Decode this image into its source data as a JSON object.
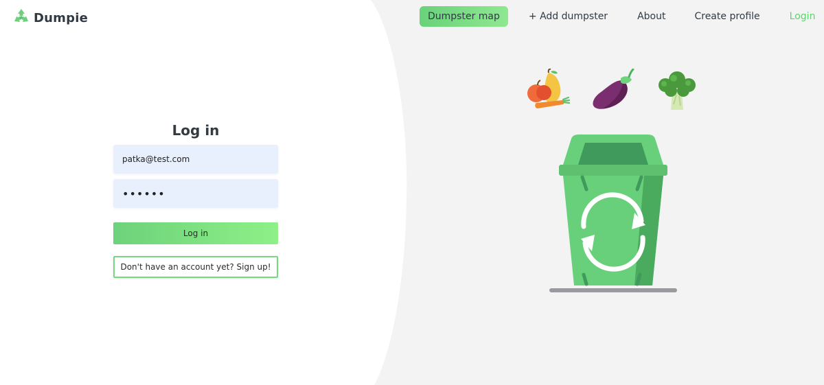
{
  "brand": {
    "name": "Dumpie",
    "logo_icon": "recycle-icon"
  },
  "nav": {
    "items": [
      {
        "label": "Dumpster map"
      },
      {
        "label": "+ Add dumpster"
      },
      {
        "label": "About"
      },
      {
        "label": "Create profile"
      },
      {
        "label": "Login"
      }
    ]
  },
  "login": {
    "title": "Log in",
    "email_value": "patka@test.com",
    "password_mask": "••••••",
    "submit_label": "Log in",
    "signup_label": "Don't have an account yet? Sign up!"
  },
  "illustration": {
    "icons": [
      "fruits-icon",
      "eggplant-icon",
      "broccoli-icon",
      "recycling-bin-icon"
    ]
  },
  "colors": {
    "accent": "#6dd27b",
    "accent_text": "#5ed36f",
    "bin_green": "#68d07a",
    "bin_dark": "#3f9a5b",
    "field_bg": "#e8f0fe",
    "right_bg": "#f3f3f3"
  }
}
